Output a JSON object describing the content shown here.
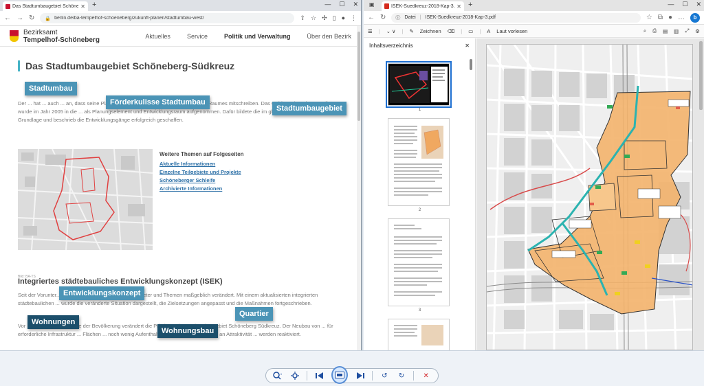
{
  "left_browser": {
    "tab_title": "Das Stadtumbaugebiet Schöneb...",
    "url": "berlin.de/ba-tempelhof-schoeneberg/zukunft-planen/stadtumbau-west/",
    "site": {
      "brand_line1": "Bezirksamt",
      "brand_line2": "Tempelhof-Schöneberg",
      "nav": [
        "Aktuelles",
        "Service",
        "Politik und Verwaltung",
        "Über den Bezirk"
      ]
    },
    "page_title": "Das Stadtumbaugebiet Schöneberg-Südkreuz",
    "intro_text": "Der ... hat ... auch ... an, dass seine Planungsinstrumente die Veränderungen ihres Raumes mitschreiben. Das Gebiet Schöneberg Südkreuz wurde im Jahr 2005 in die ... als Planungselement und Entwicklungsraum aufgenommen. Dafür bildete die im gleichen Jahr erstellte ... die Grundlage und beschrieb die Entwicklungsgänge erfolgreich geschaffen.",
    "image_caption": "Bild: BA-TS",
    "themes_heading": "Weitere Themen auf Folgeseiten",
    "theme_links": [
      "Aktuelle Informationen",
      "Einzelne Teilgebiete und Projekte",
      "Schöneberger Schleife",
      "Archivierte Informationen"
    ],
    "section_heading": "Integriertes städtebauliches Entwicklungskonzept (ISEK)",
    "section_text_1": "Seit der Vorunter... im Jahr 2005 haben sich die Parameter und Themen maßgeblich verändert. Mit einem aktualisierten integrierten städtebaulichen ... wurde die veränderte Situation dargestellt, die Zielsetzungen angepasst und die Maßnahmen fortgeschrieben.",
    "section_text_2": "Vor ... anhaltende Zunahme der Bevölkerung verändert die Prioritäten im Stadtumbaugebiet Schöneberg Südkreuz. Der Neubau von ... für erforderliche Infrastruktur ... Flächen ... noch wenig Aufenthaltsqualität ... gewinnen jetzt an Attraktivität ... werden reaktiviert."
  },
  "keywords": {
    "stadtumbau": "Stadtumbau",
    "foerderkulisse": "Förderkulisse Stadtumbau",
    "stadtumbaugebiet": "Stadtumbaugebiet",
    "entwicklungskonzept": "Entwicklungskonzept",
    "quartier": "Quartier",
    "wohnungen": "Wohnungen",
    "wohnungsbau": "Wohnungsbau"
  },
  "right_browser": {
    "tab_title": "ISEK-Suedkreuz-2018-Kap-3.pdf",
    "addr_label": "Datei",
    "addr_value": "ISEK-Suedkreuz-2018-Kap-3.pdf",
    "toolbar": {
      "draw": "Zeichnen",
      "read_aloud": "Laut vorlesen"
    },
    "panel_title": "Inhaltsverzeichnis",
    "pages": [
      "1",
      "2",
      "3"
    ]
  },
  "colors": {
    "keyword_light": "#4b94b6",
    "keyword_dark": "#1c4f6b",
    "accent_teal": "#45b3c6",
    "map_orange": "#f3b36b"
  }
}
